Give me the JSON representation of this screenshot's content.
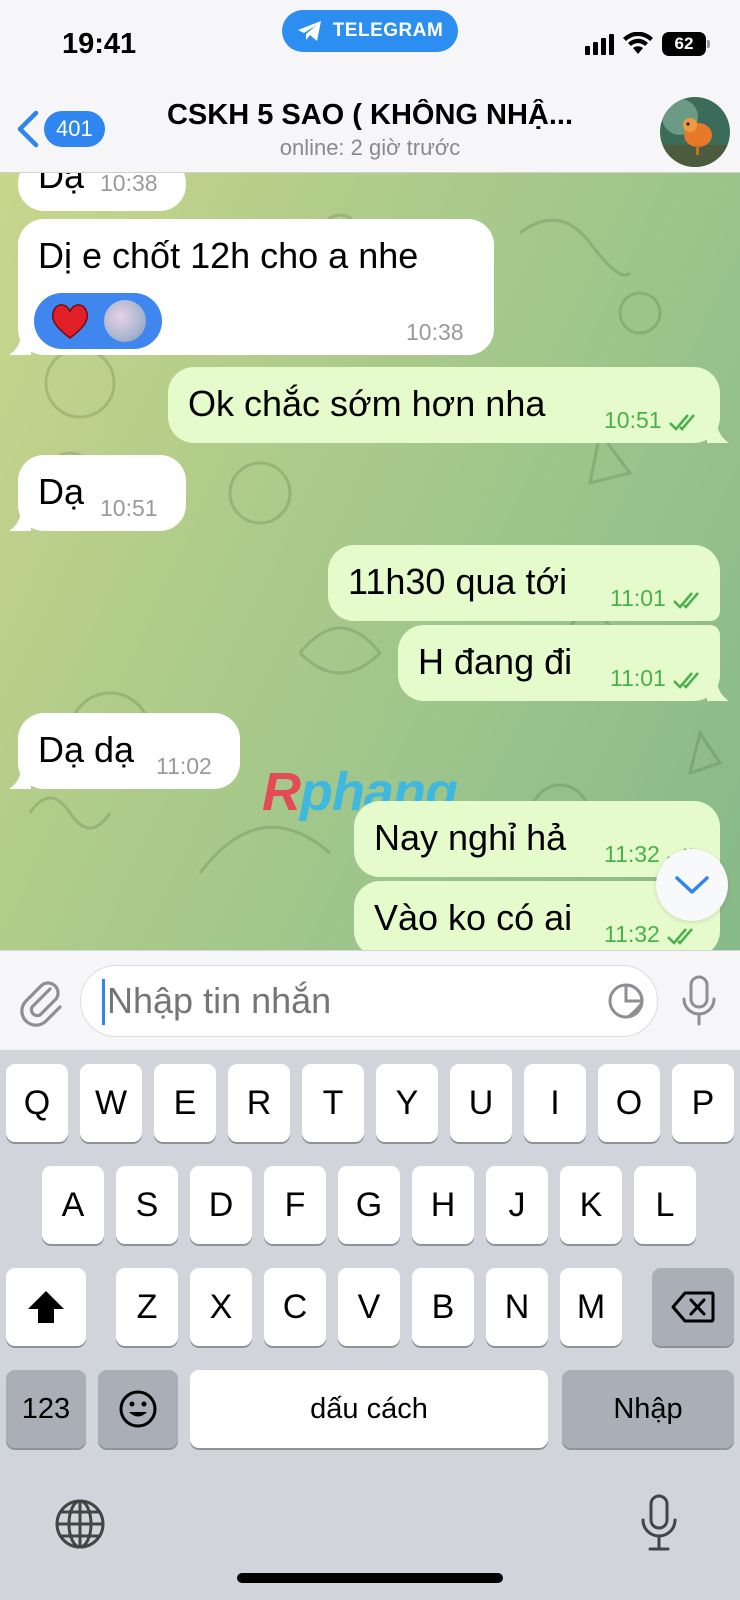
{
  "status_bar": {
    "time": "19:41",
    "app_indicator": "TELEGRAM",
    "battery": "62",
    "icons": [
      "signal-icon",
      "wifi-icon",
      "battery-icon"
    ]
  },
  "header": {
    "back_count": "401",
    "title": "CSKH 5 SAO ( KHÔNG NHẬ...",
    "subtitle": "online: 2 giờ trước"
  },
  "messages": [
    {
      "direction": "in",
      "text": "Dạ",
      "time": "10:38"
    },
    {
      "direction": "in",
      "text": "Dị e chốt 12h cho a nhe",
      "time": "10:38",
      "reactions": [
        "heart",
        "user-avatar"
      ]
    },
    {
      "direction": "out",
      "text": "Ok chắc sớm hơn nha",
      "time": "10:51",
      "read": true
    },
    {
      "direction": "in",
      "text": "Dạ",
      "time": "10:51"
    },
    {
      "direction": "out",
      "text": "11h30 qua tới",
      "time": "11:01",
      "read": true
    },
    {
      "direction": "out",
      "text": "H đang đi",
      "time": "11:01",
      "read": true
    },
    {
      "direction": "in",
      "text": "Dạ dạ",
      "time": "11:02"
    },
    {
      "direction": "out",
      "text": "Nay nghỉ hả",
      "time": "11:32",
      "read": true
    },
    {
      "direction": "out",
      "text": "Vào ko có ai",
      "time": "11:32",
      "read": true
    }
  ],
  "watermark": {
    "part1": "R",
    "part2": "phang"
  },
  "input": {
    "placeholder": "Nhập tin nhắn"
  },
  "keyboard": {
    "row1": [
      "Q",
      "W",
      "E",
      "R",
      "T",
      "Y",
      "U",
      "I",
      "O",
      "P"
    ],
    "row2": [
      "A",
      "S",
      "D",
      "F",
      "G",
      "H",
      "J",
      "K",
      "L"
    ],
    "row3": [
      "Z",
      "X",
      "C",
      "V",
      "B",
      "N",
      "M"
    ],
    "numbers_key": "123",
    "space_key": "dấu cách",
    "return_key": "Nhập"
  },
  "colors": {
    "accent": "#2f86ef",
    "outgoing_bubble": "#e6fbcb",
    "incoming_bubble": "#ffffff",
    "read_check": "#4bb04c"
  }
}
